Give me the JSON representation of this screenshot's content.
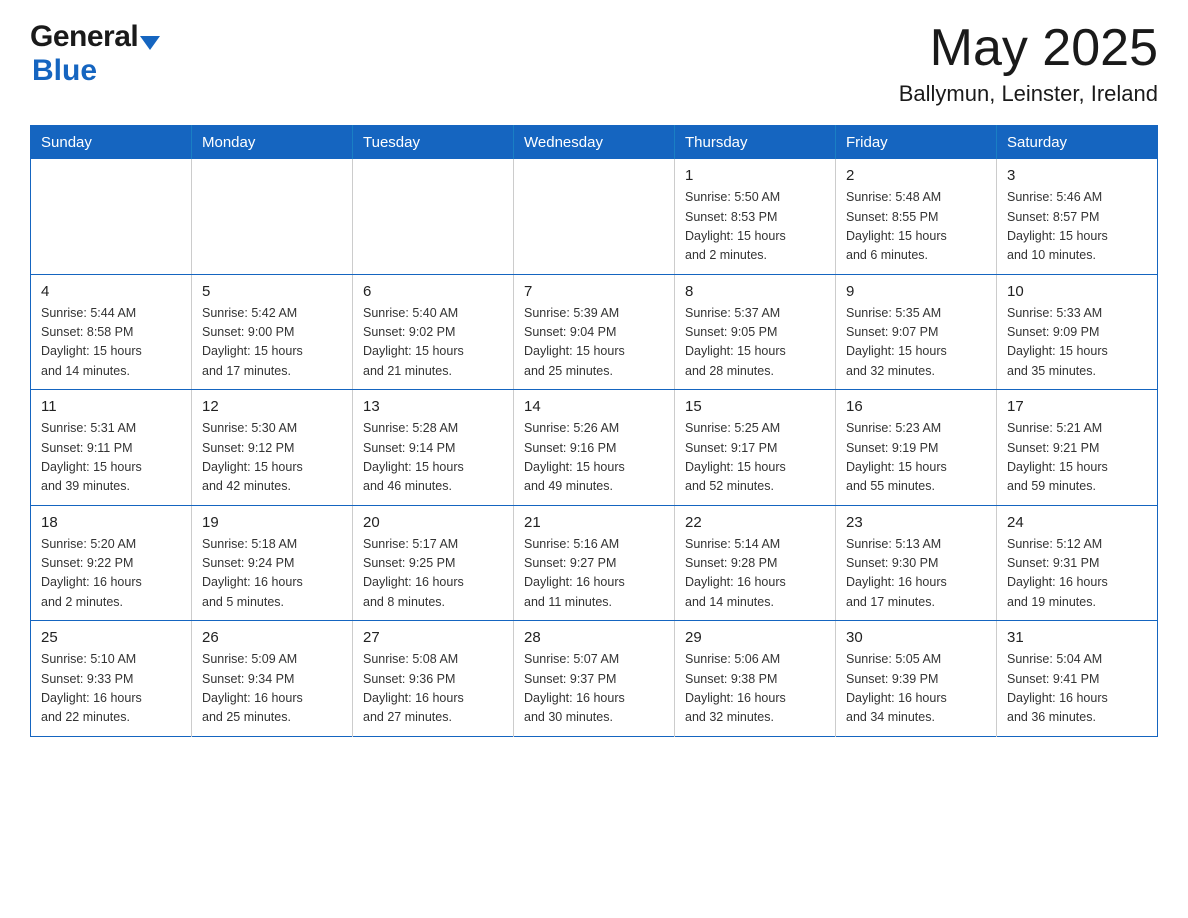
{
  "header": {
    "logo_general": "General",
    "logo_blue": "Blue",
    "month_title": "May 2025",
    "location": "Ballymun, Leinster, Ireland"
  },
  "weekdays": [
    "Sunday",
    "Monday",
    "Tuesday",
    "Wednesday",
    "Thursday",
    "Friday",
    "Saturday"
  ],
  "weeks": [
    [
      {
        "day": "",
        "info": ""
      },
      {
        "day": "",
        "info": ""
      },
      {
        "day": "",
        "info": ""
      },
      {
        "day": "",
        "info": ""
      },
      {
        "day": "1",
        "info": "Sunrise: 5:50 AM\nSunset: 8:53 PM\nDaylight: 15 hours\nand 2 minutes."
      },
      {
        "day": "2",
        "info": "Sunrise: 5:48 AM\nSunset: 8:55 PM\nDaylight: 15 hours\nand 6 minutes."
      },
      {
        "day": "3",
        "info": "Sunrise: 5:46 AM\nSunset: 8:57 PM\nDaylight: 15 hours\nand 10 minutes."
      }
    ],
    [
      {
        "day": "4",
        "info": "Sunrise: 5:44 AM\nSunset: 8:58 PM\nDaylight: 15 hours\nand 14 minutes."
      },
      {
        "day": "5",
        "info": "Sunrise: 5:42 AM\nSunset: 9:00 PM\nDaylight: 15 hours\nand 17 minutes."
      },
      {
        "day": "6",
        "info": "Sunrise: 5:40 AM\nSunset: 9:02 PM\nDaylight: 15 hours\nand 21 minutes."
      },
      {
        "day": "7",
        "info": "Sunrise: 5:39 AM\nSunset: 9:04 PM\nDaylight: 15 hours\nand 25 minutes."
      },
      {
        "day": "8",
        "info": "Sunrise: 5:37 AM\nSunset: 9:05 PM\nDaylight: 15 hours\nand 28 minutes."
      },
      {
        "day": "9",
        "info": "Sunrise: 5:35 AM\nSunset: 9:07 PM\nDaylight: 15 hours\nand 32 minutes."
      },
      {
        "day": "10",
        "info": "Sunrise: 5:33 AM\nSunset: 9:09 PM\nDaylight: 15 hours\nand 35 minutes."
      }
    ],
    [
      {
        "day": "11",
        "info": "Sunrise: 5:31 AM\nSunset: 9:11 PM\nDaylight: 15 hours\nand 39 minutes."
      },
      {
        "day": "12",
        "info": "Sunrise: 5:30 AM\nSunset: 9:12 PM\nDaylight: 15 hours\nand 42 minutes."
      },
      {
        "day": "13",
        "info": "Sunrise: 5:28 AM\nSunset: 9:14 PM\nDaylight: 15 hours\nand 46 minutes."
      },
      {
        "day": "14",
        "info": "Sunrise: 5:26 AM\nSunset: 9:16 PM\nDaylight: 15 hours\nand 49 minutes."
      },
      {
        "day": "15",
        "info": "Sunrise: 5:25 AM\nSunset: 9:17 PM\nDaylight: 15 hours\nand 52 minutes."
      },
      {
        "day": "16",
        "info": "Sunrise: 5:23 AM\nSunset: 9:19 PM\nDaylight: 15 hours\nand 55 minutes."
      },
      {
        "day": "17",
        "info": "Sunrise: 5:21 AM\nSunset: 9:21 PM\nDaylight: 15 hours\nand 59 minutes."
      }
    ],
    [
      {
        "day": "18",
        "info": "Sunrise: 5:20 AM\nSunset: 9:22 PM\nDaylight: 16 hours\nand 2 minutes."
      },
      {
        "day": "19",
        "info": "Sunrise: 5:18 AM\nSunset: 9:24 PM\nDaylight: 16 hours\nand 5 minutes."
      },
      {
        "day": "20",
        "info": "Sunrise: 5:17 AM\nSunset: 9:25 PM\nDaylight: 16 hours\nand 8 minutes."
      },
      {
        "day": "21",
        "info": "Sunrise: 5:16 AM\nSunset: 9:27 PM\nDaylight: 16 hours\nand 11 minutes."
      },
      {
        "day": "22",
        "info": "Sunrise: 5:14 AM\nSunset: 9:28 PM\nDaylight: 16 hours\nand 14 minutes."
      },
      {
        "day": "23",
        "info": "Sunrise: 5:13 AM\nSunset: 9:30 PM\nDaylight: 16 hours\nand 17 minutes."
      },
      {
        "day": "24",
        "info": "Sunrise: 5:12 AM\nSunset: 9:31 PM\nDaylight: 16 hours\nand 19 minutes."
      }
    ],
    [
      {
        "day": "25",
        "info": "Sunrise: 5:10 AM\nSunset: 9:33 PM\nDaylight: 16 hours\nand 22 minutes."
      },
      {
        "day": "26",
        "info": "Sunrise: 5:09 AM\nSunset: 9:34 PM\nDaylight: 16 hours\nand 25 minutes."
      },
      {
        "day": "27",
        "info": "Sunrise: 5:08 AM\nSunset: 9:36 PM\nDaylight: 16 hours\nand 27 minutes."
      },
      {
        "day": "28",
        "info": "Sunrise: 5:07 AM\nSunset: 9:37 PM\nDaylight: 16 hours\nand 30 minutes."
      },
      {
        "day": "29",
        "info": "Sunrise: 5:06 AM\nSunset: 9:38 PM\nDaylight: 16 hours\nand 32 minutes."
      },
      {
        "day": "30",
        "info": "Sunrise: 5:05 AM\nSunset: 9:39 PM\nDaylight: 16 hours\nand 34 minutes."
      },
      {
        "day": "31",
        "info": "Sunrise: 5:04 AM\nSunset: 9:41 PM\nDaylight: 16 hours\nand 36 minutes."
      }
    ]
  ]
}
